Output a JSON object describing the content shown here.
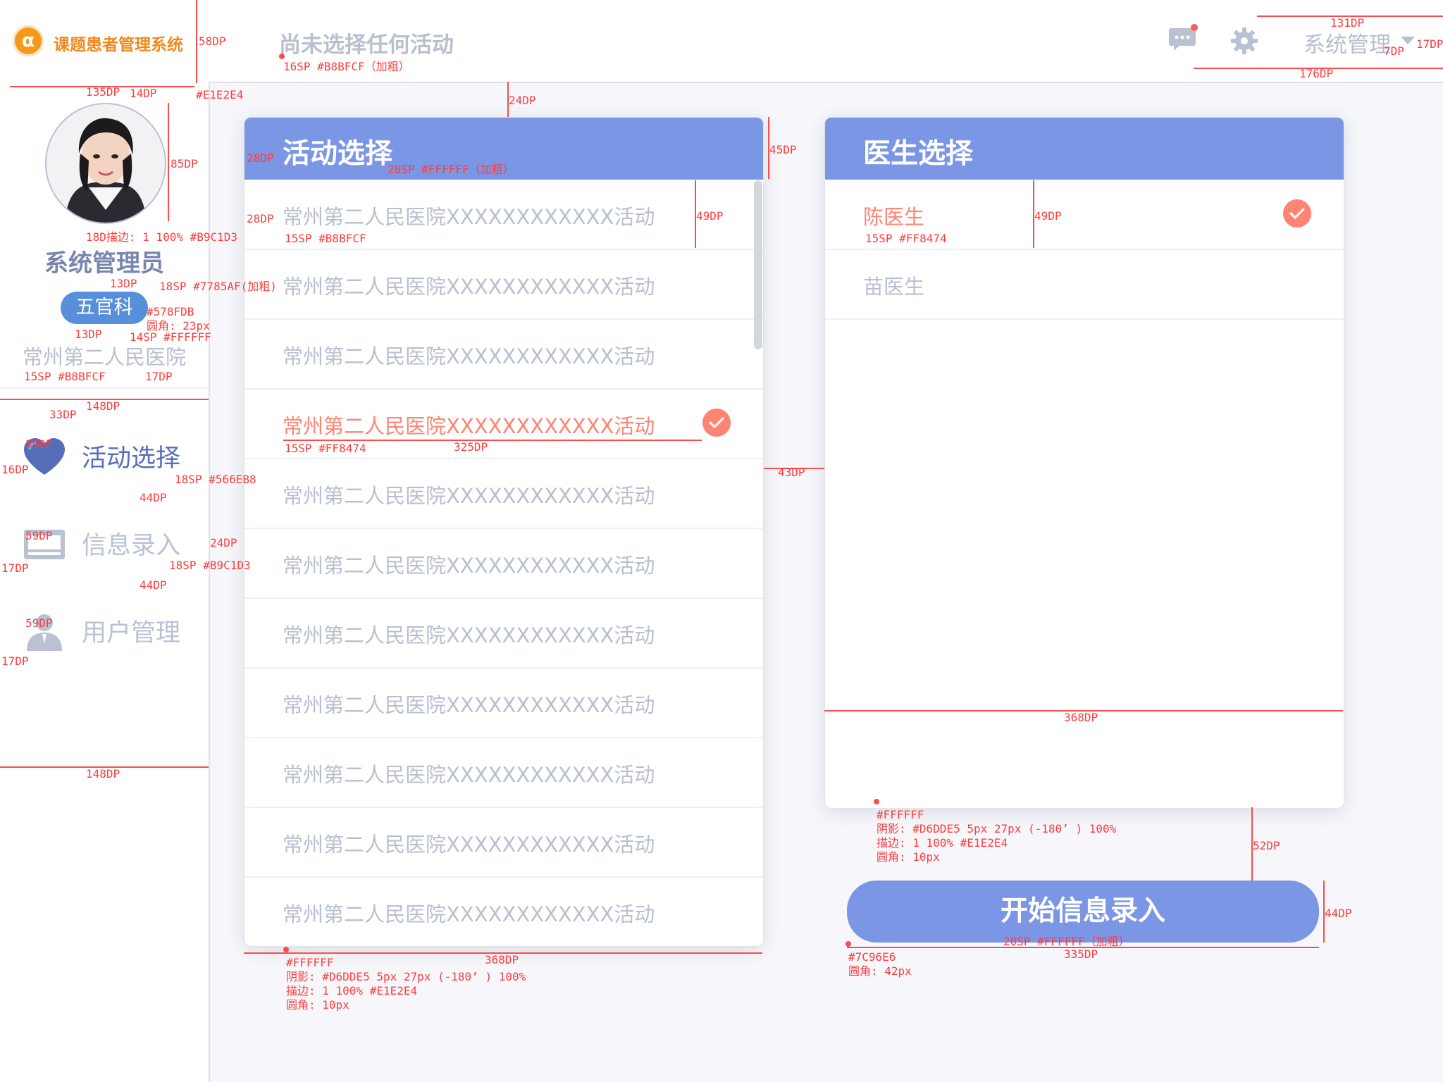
{
  "app": {
    "title": "课题患者管理系统",
    "logo_glyph": "α"
  },
  "header": {
    "page_title": "尚未选择任何活动",
    "admin_label": "系统管理"
  },
  "user": {
    "name": "系统管理员",
    "department": "五官科",
    "hospital": "常州第二人民医院"
  },
  "nav": [
    {
      "label": "活动选择",
      "active": true,
      "color": "#566EB8"
    },
    {
      "label": "信息录入",
      "active": false,
      "color": "#B9C1D3"
    },
    {
      "label": "用户管理",
      "active": false,
      "color": "#B9C1D3"
    }
  ],
  "activity_panel": {
    "title": "活动选择",
    "items": [
      {
        "label": "常州第二人民医院XXXXXXXXXXXX活动",
        "selected": false
      },
      {
        "label": "常州第二人民医院XXXXXXXXXXXX活动",
        "selected": false
      },
      {
        "label": "常州第二人民医院XXXXXXXXXXXX活动",
        "selected": false
      },
      {
        "label": "常州第二人民医院XXXXXXXXXXXX活动",
        "selected": true
      },
      {
        "label": "常州第二人民医院XXXXXXXXXXXX活动",
        "selected": false
      },
      {
        "label": "常州第二人民医院XXXXXXXXXXXX活动",
        "selected": false
      },
      {
        "label": "常州第二人民医院XXXXXXXXXXXX活动",
        "selected": false
      },
      {
        "label": "常州第二人民医院XXXXXXXXXXXX活动",
        "selected": false
      },
      {
        "label": "常州第二人民医院XXXXXXXXXXXX活动",
        "selected": false
      },
      {
        "label": "常州第二人民医院XXXXXXXXXXXX活动",
        "selected": false
      },
      {
        "label": "常州第二人民医院XXXXXXXXXXXX活动",
        "selected": false
      }
    ]
  },
  "doctor_panel": {
    "title": "医生选择",
    "items": [
      {
        "label": "陈医生",
        "selected": true
      },
      {
        "label": "苗医生",
        "selected": false
      }
    ]
  },
  "start_button": {
    "label": "开始信息录入"
  },
  "colors": {
    "primary": "#7C96E6",
    "selected": "#FF8474",
    "muted_text": "#B8BFCF",
    "name_text": "#7785AF",
    "badge": "#578FDB",
    "border": "#E1E2E4",
    "shadow": "#D6DDE5"
  },
  "annotations": {
    "a_58dp": "58DP",
    "a_title_spec": "16SP #B8BFCF（加粗）",
    "a_135dp": "135DP",
    "a_14dp": "14DP",
    "a_divider_color": "#E1E2E4",
    "a_24dp_top": "24DP",
    "a_131dp": "131DP",
    "a_17dp_r": "17DP",
    "a_7dp": "7DP",
    "a_176dp": "176DP",
    "a_85dp": "85DP",
    "a_18dp_stroke": "18D描边: 1 100% #B9C1D3",
    "a_13dp_1": "13DP",
    "a_name_spec": "18SP #7785AF(加粗)",
    "a_badge_color": "#578FDB",
    "a_badge_radius": "圆角: 23px",
    "a_13dp_2": "13DP",
    "a_badge_text": "14SP #FFFFFF",
    "a_hosp_spec": "15SP #B8BFCF",
    "a_17dp_h": "17DP",
    "a_148dp_1": "148DP",
    "a_33dp": "33DP",
    "a_59dp_1": "59DP",
    "a_16dp": "16DP",
    "a_nav1_spec": "18SP #566EB8",
    "a_44dp_1": "44DP",
    "a_59dp_2": "59DP",
    "a_24dp_nav": "24DP",
    "a_17dp_n1": "17DP",
    "a_nav2_spec": "18SP #B9C1D3",
    "a_44dp_2": "44DP",
    "a_59dp_3": "59DP",
    "a_17dp_n2": "17DP",
    "a_148dp_2": "148DP",
    "a_28dp_head": "28DP",
    "a_head_spec": "20SP #FFFFFF（加粗）",
    "a_45dp": "45DP",
    "a_28dp_row": "28DP",
    "a_row_spec": "15SP #B8BFCF",
    "a_49dp_1": "49DP",
    "a_sel_spec": "15SP #FF8474",
    "a_325dp": "325DP",
    "a_43dp": "43DP",
    "a_doc_sel_spec": "15SP #FF8474",
    "a_49dp_2": "49DP",
    "a_368dp_r": "368DP",
    "a_panel_bg": "#FFFFFF",
    "a_panel_shadow": "阴影: #D6DDE5 5px 27px (-180’ ) 100%",
    "a_panel_stroke": "描边: 1 100% #E1E2E4",
    "a_panel_radius": "圆角: 10px",
    "a_52dp": "52DP",
    "a_44dp_btn": "44DP",
    "a_btn_text": "20SP #FFFFFF（加粗）",
    "a_335dp": "335DP",
    "a_btn_color": "#7C96E6",
    "a_btn_radius": "圆角: 42px",
    "a_368dp_l": "368DP",
    "a_lpanel_bg": "#FFFFFF",
    "a_lpanel_shadow": "阴影: #D6DDE5 5px 27px (-180’ ) 100%",
    "a_lpanel_stroke": "描边: 1 100% #E1E2E4",
    "a_lpanel_radius": "圆角: 10px"
  }
}
